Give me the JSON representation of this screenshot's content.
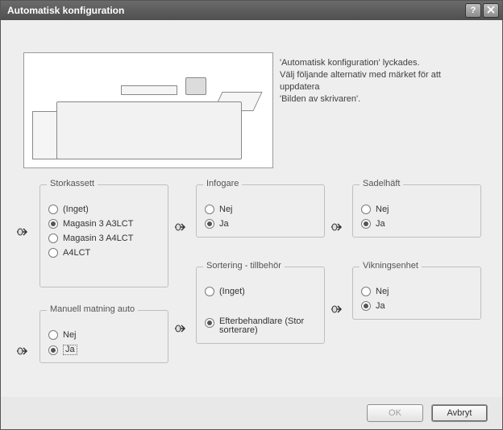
{
  "window": {
    "title": "Automatisk konfiguration"
  },
  "info": {
    "line1": "'Automatisk konfiguration' lyckades.",
    "line2": "Välj följande alternativ med märket för att uppdatera",
    "line3": "'Bilden av skrivaren'."
  },
  "groups": {
    "storkassett": {
      "title": "Storkassett",
      "options": [
        {
          "label": "(Inget)",
          "selected": false
        },
        {
          "label": "Magasin 3  A3LCT",
          "selected": true
        },
        {
          "label": "Magasin 3  A4LCT",
          "selected": false
        },
        {
          "label": "A4LCT",
          "selected": false
        }
      ]
    },
    "manuell": {
      "title": "Manuell matning auto",
      "options": [
        {
          "label": "Nej",
          "selected": false
        },
        {
          "label": "Ja",
          "selected": true
        }
      ]
    },
    "infogare": {
      "title": "Infogare",
      "options": [
        {
          "label": "Nej",
          "selected": false
        },
        {
          "label": "Ja",
          "selected": true
        }
      ]
    },
    "sortering": {
      "title": "Sortering - tillbehör",
      "options": [
        {
          "label": "(Inget)",
          "selected": false
        },
        {
          "label": "Efterbehandlare (Stor sorterare)",
          "selected": true
        }
      ]
    },
    "sadelhaft": {
      "title": "Sadelhäft",
      "options": [
        {
          "label": "Nej",
          "selected": false
        },
        {
          "label": "Ja",
          "selected": true
        }
      ]
    },
    "vikning": {
      "title": "Vikningsenhet",
      "options": [
        {
          "label": "Nej",
          "selected": false
        },
        {
          "label": "Ja",
          "selected": true
        }
      ]
    }
  },
  "footer": {
    "ok": "OK",
    "cancel": "Avbryt"
  }
}
